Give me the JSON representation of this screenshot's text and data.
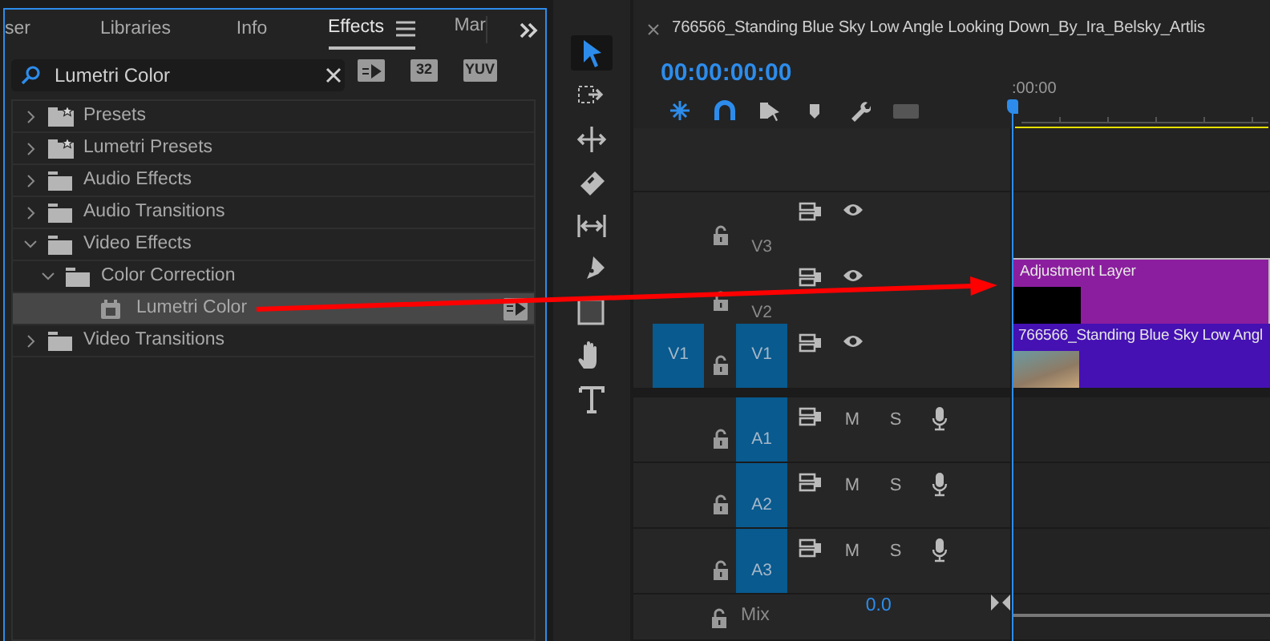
{
  "effects_panel": {
    "tabs": [
      {
        "label": "ser",
        "selected": false
      },
      {
        "label": "Libraries",
        "selected": false
      },
      {
        "label": "Info",
        "selected": false
      },
      {
        "label": "Effects",
        "selected": true
      },
      {
        "label": "Mar",
        "selected": false
      }
    ],
    "search": {
      "value": "Lumetri Color"
    },
    "filter_badges": [
      {
        "kind": "accelerated"
      },
      {
        "kind": "text",
        "label": "32"
      },
      {
        "kind": "text",
        "label": "YUV"
      }
    ],
    "tree": [
      {
        "label": "Presets",
        "kind": "preset-folder",
        "expanded": false,
        "selected": false
      },
      {
        "label": "Lumetri Presets",
        "kind": "preset-folder",
        "expanded": false,
        "selected": false
      },
      {
        "label": "Audio Effects",
        "kind": "folder",
        "expanded": false,
        "selected": false
      },
      {
        "label": "Audio Transitions",
        "kind": "folder",
        "expanded": false,
        "selected": false
      },
      {
        "label": "Video Effects",
        "kind": "folder",
        "expanded": true,
        "selected": false,
        "children": [
          {
            "label": "Color Correction",
            "kind": "folder",
            "expanded": true,
            "selected": false,
            "children": [
              {
                "label": "Lumetri Color",
                "kind": "effect",
                "selected": true
              }
            ]
          }
        ]
      },
      {
        "label": "Video Transitions",
        "kind": "folder",
        "expanded": false,
        "selected": false
      }
    ]
  },
  "tools": [
    {
      "kind": "selection",
      "selected": true
    },
    {
      "kind": "track-select",
      "selected": false
    },
    {
      "kind": "ripple",
      "selected": false
    },
    {
      "kind": "razor",
      "selected": false
    },
    {
      "kind": "slip",
      "selected": false
    },
    {
      "kind": "pen",
      "selected": false
    },
    {
      "kind": "rectangle",
      "selected": false
    },
    {
      "kind": "hand",
      "selected": false
    },
    {
      "kind": "type",
      "selected": false
    }
  ],
  "timeline": {
    "title": "766566_Standing Blue Sky Low Angle Looking Down_By_Ira_Belsky_Artlis",
    "timecode": "00:00:00:00",
    "ruler_label": ":00:00",
    "video_tracks": [
      {
        "label": "V3",
        "targeted": false
      },
      {
        "label": "V2",
        "targeted": false,
        "clip": {
          "kind": "adjustment",
          "title": "Adjustment Layer",
          "color": "#8b1e9e"
        }
      },
      {
        "source_patch": "V1",
        "label": "V1",
        "targeted": true,
        "clip": {
          "kind": "video",
          "title": "766566_Standing Blue Sky Low Angl",
          "color": "#4511b3"
        }
      }
    ],
    "audio_tracks": [
      {
        "label": "A1",
        "targeted": true,
        "mute": "M",
        "solo": "S"
      },
      {
        "label": "A2",
        "targeted": true,
        "mute": "M",
        "solo": "S"
      },
      {
        "label": "A3",
        "targeted": true,
        "mute": "M",
        "solo": "S"
      }
    ],
    "mix": {
      "label": "Mix",
      "value": "0.0"
    }
  },
  "annotations": [
    {
      "kind": "arrow"
    }
  ]
}
